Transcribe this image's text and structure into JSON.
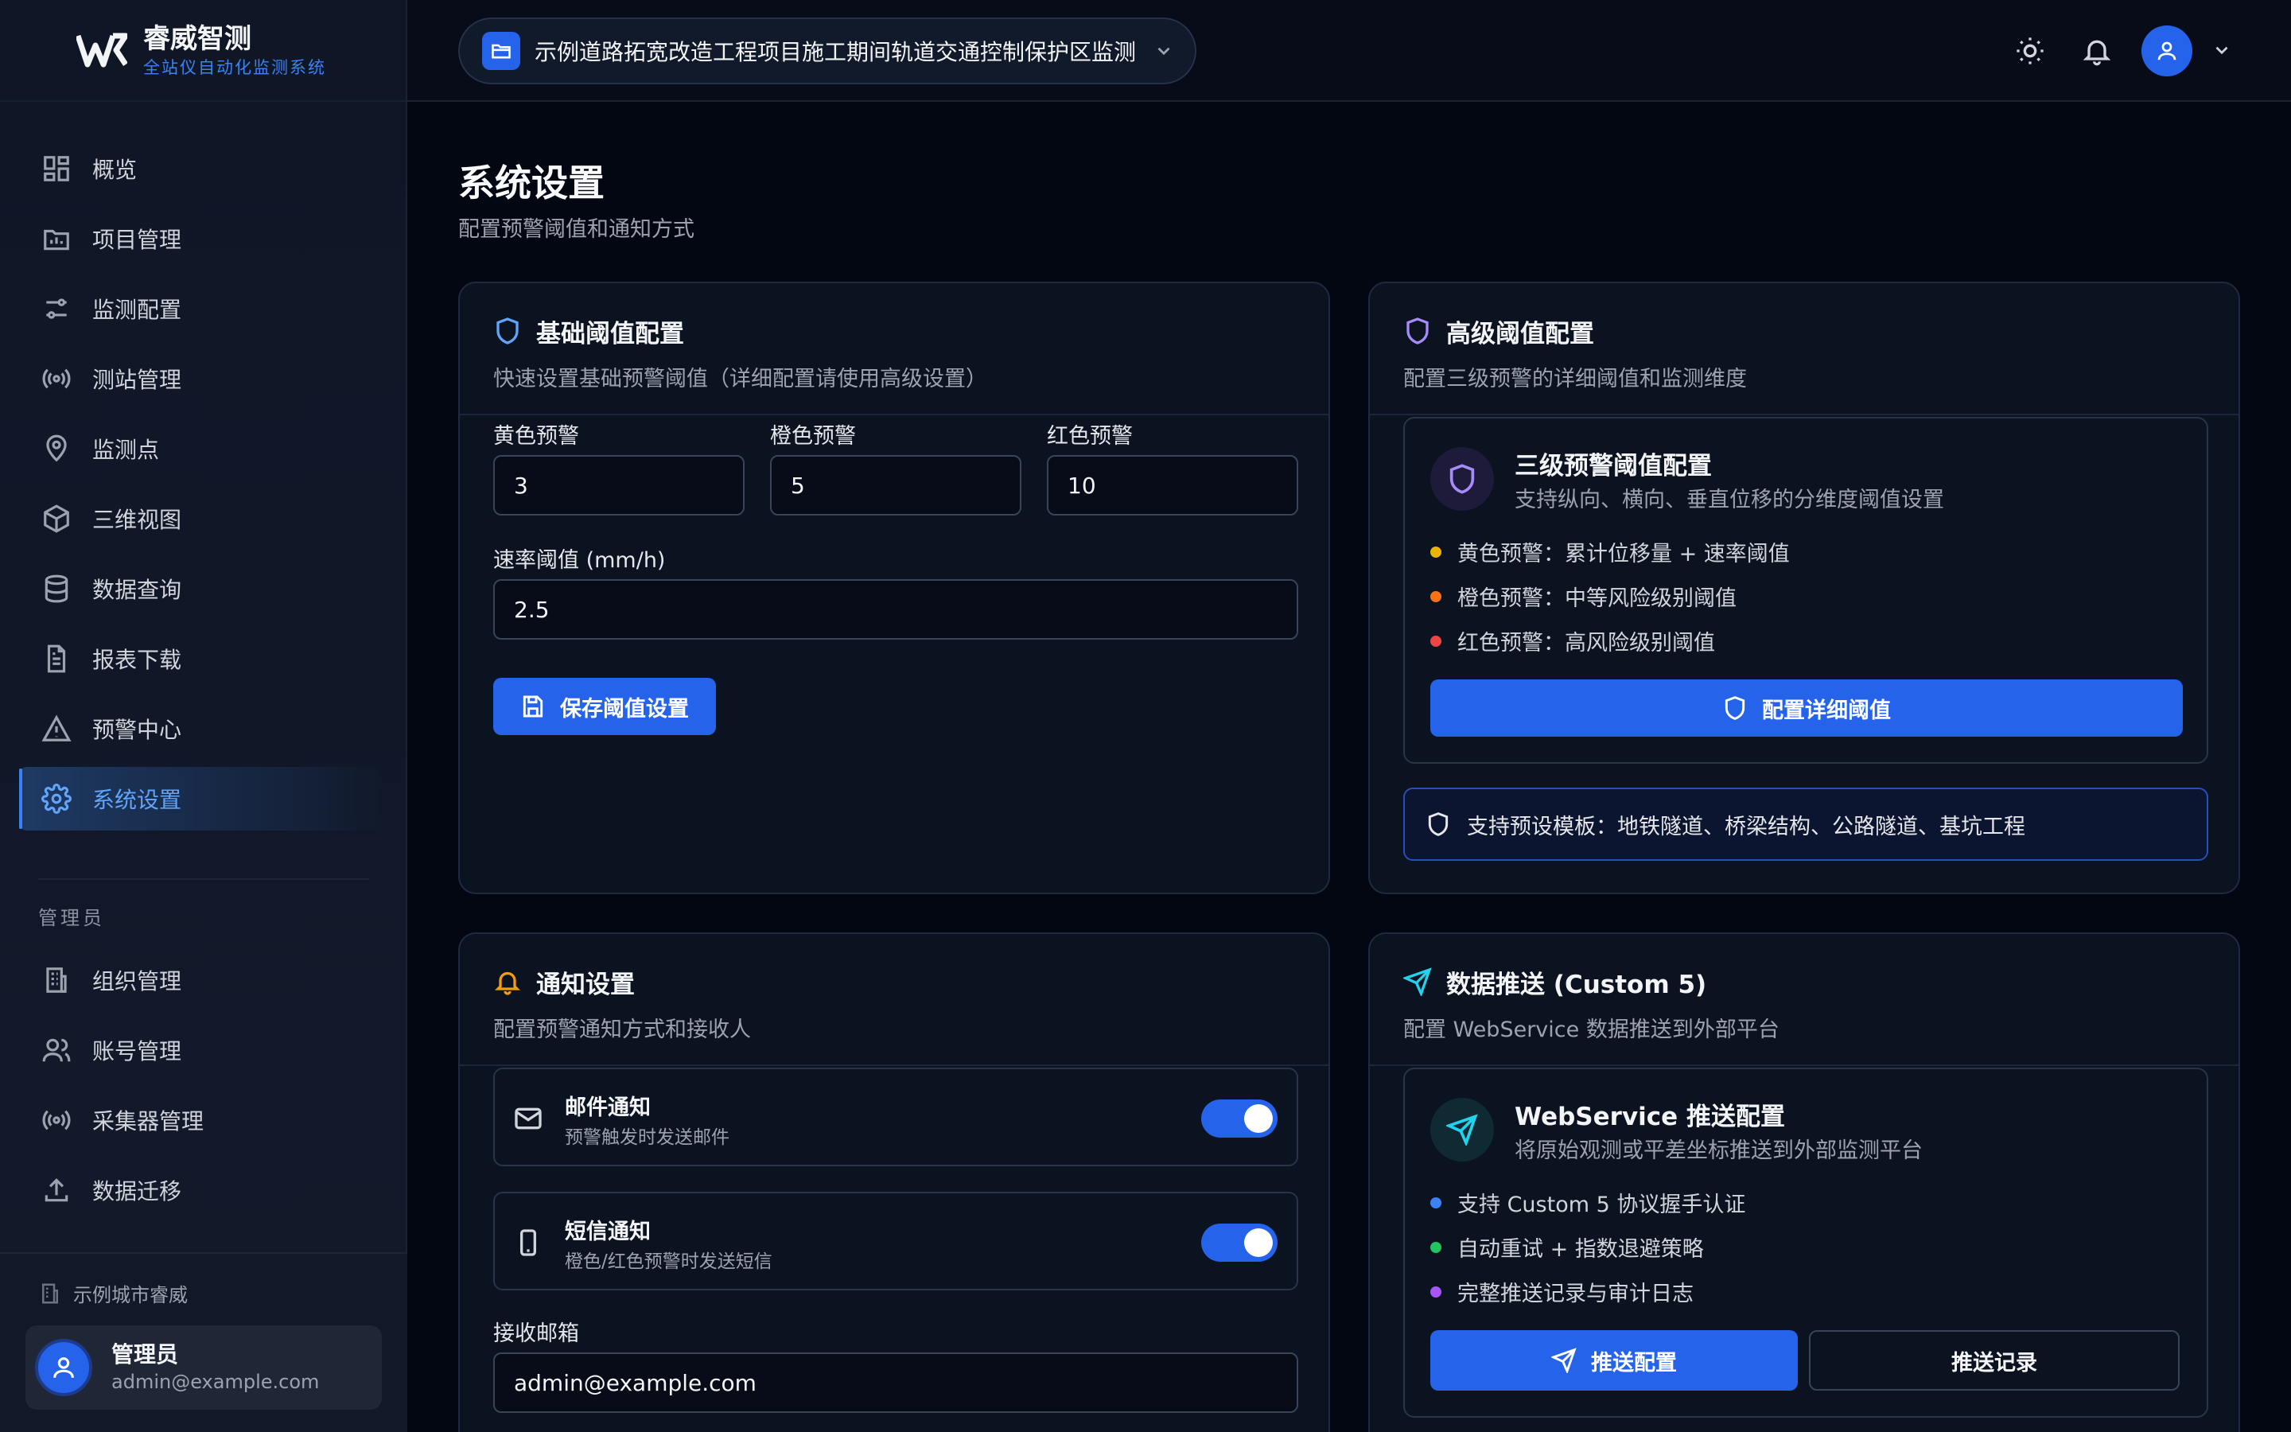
{
  "brand": {
    "title": "睿威智测",
    "subtitle": "全站仪自动化监测系统"
  },
  "sidebar": {
    "items": [
      {
        "label": "概览",
        "icon": "grid-icon"
      },
      {
        "label": "项目管理",
        "icon": "folder-chart-icon"
      },
      {
        "label": "监测配置",
        "icon": "sliders-icon"
      },
      {
        "label": "测站管理",
        "icon": "radio-icon"
      },
      {
        "label": "监测点",
        "icon": "map-pin-icon"
      },
      {
        "label": "三维视图",
        "icon": "cube-icon"
      },
      {
        "label": "数据查询",
        "icon": "database-icon"
      },
      {
        "label": "报表下载",
        "icon": "file-text-icon"
      },
      {
        "label": "预警中心",
        "icon": "alert-triangle-icon"
      },
      {
        "label": "系统设置",
        "icon": "gear-icon",
        "active": true
      }
    ],
    "admin_section": "管理员",
    "admin_items": [
      {
        "label": "组织管理",
        "icon": "building-icon"
      },
      {
        "label": "账号管理",
        "icon": "users-icon"
      },
      {
        "label": "采集器管理",
        "icon": "radio-icon"
      },
      {
        "label": "数据迁移",
        "icon": "upload-icon"
      }
    ],
    "org": "示例城市睿威",
    "user": {
      "name": "管理员",
      "email": "admin@example.com"
    }
  },
  "topbar": {
    "project": "示例道路拓宽改造工程项目施工期间轨道交通控制保护区监测"
  },
  "page": {
    "title": "系统设置",
    "subtitle": "配置预警阈值和通知方式"
  },
  "basic": {
    "title": "基础阈值配置",
    "desc": "快速设置基础预警阈值（详细配置请使用高级设置）",
    "yellow_label": "黄色预警",
    "yellow_value": "3",
    "orange_label": "橙色预警",
    "orange_value": "5",
    "red_label": "红色预警",
    "red_value": "10",
    "rate_label": "速率阈值 (mm/h)",
    "rate_value": "2.5",
    "save": "保存阈值设置"
  },
  "advanced": {
    "title": "高级阈值配置",
    "desc": "配置三级预警的详细阈值和监测维度",
    "box_title": "三级预警阈值配置",
    "box_sub": "支持纵向、横向、垂直位移的分维度阈值设置",
    "bullets": [
      "黄色预警：累计位移量 + 速率阈值",
      "橙色预警：中等风险级别阈值",
      "红色预警：高风险级别阈值"
    ],
    "bullet_colors": [
      "#eab308",
      "#f97316",
      "#ef4444"
    ],
    "button": "配置详细阈值",
    "tip": "支持预设模板：地铁隧道、桥梁结构、公路隧道、基坑工程"
  },
  "notify": {
    "title": "通知设置",
    "desc": "配置预警通知方式和接收人",
    "email_title": "邮件通知",
    "email_desc": "预警触发时发送邮件",
    "sms_title": "短信通知",
    "sms_desc": "橙色/红色预警时发送短信",
    "recv_label": "接收邮箱",
    "recv_value": "admin@example.com"
  },
  "push": {
    "title": "数据推送 (Custom 5)",
    "desc": "配置 WebService 数据推送到外部平台",
    "box_title": "WebService 推送配置",
    "box_sub": "将原始观测或平差坐标推送到外部监测平台",
    "bullets": [
      "支持 Custom 5 协议握手认证",
      "自动重试 + 指数退避策略",
      "完整推送记录与审计日志"
    ],
    "bullet_colors": [
      "#3b82f6",
      "#22c55e",
      "#a855f7"
    ],
    "config_button": "推送配置",
    "log_button": "推送记录"
  },
  "colors": {
    "accent": "#2563eb",
    "background": "#030712",
    "card": "#0b1220"
  }
}
